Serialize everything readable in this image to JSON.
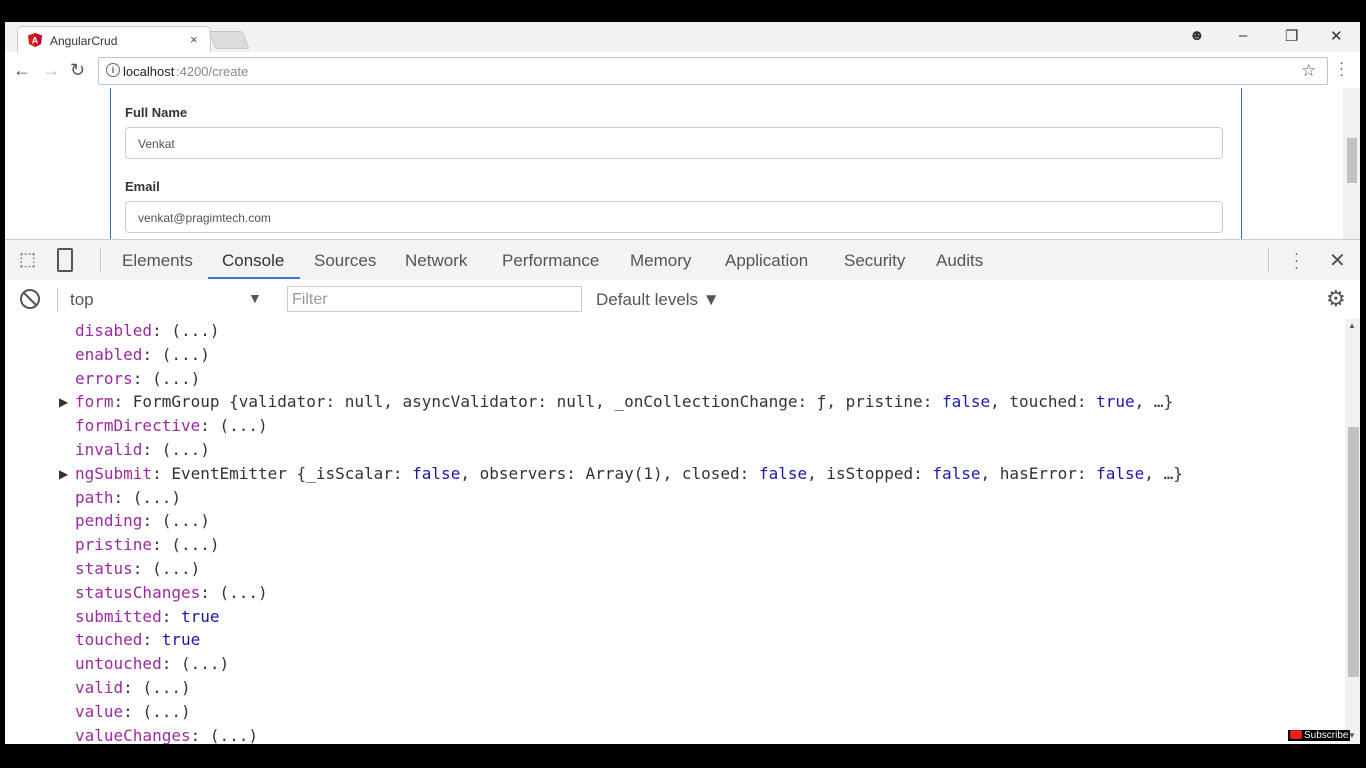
{
  "browser": {
    "tab_title": "AngularCrud",
    "tab_close": "×",
    "window_controls": [
      "–",
      "❐",
      "✕"
    ],
    "url_host": "localhost",
    "url_path": ":4200/create"
  },
  "page": {
    "fields": [
      {
        "label": "Full Name",
        "value": "Venkat"
      },
      {
        "label": "Email",
        "value": "venkat@pragimtech.com"
      }
    ]
  },
  "devtools": {
    "tabs": [
      "Elements",
      "Console",
      "Sources",
      "Network",
      "Performance",
      "Memory",
      "Application",
      "Security",
      "Audits"
    ],
    "active_tab": "Console",
    "context": "top",
    "filter_placeholder": "Filter",
    "levels_label": "Default levels ▼"
  },
  "console": {
    "lines": [
      {
        "key": "disabled",
        "rest": ": (...)"
      },
      {
        "key": "enabled",
        "rest": ": (...)"
      },
      {
        "key": "errors",
        "rest": ": (...)"
      },
      {
        "key": "form",
        "expandable": true,
        "rest": ": FormGroup {validator: null, asyncValidator: null, _onCollectionChange: ƒ, pristine: false, touched: true, …}"
      },
      {
        "key": "formDirective",
        "rest": ": (...)"
      },
      {
        "key": "invalid",
        "rest": ": (...)"
      },
      {
        "key": "ngSubmit",
        "expandable": true,
        "rest": ": EventEmitter {_isScalar: false, observers: Array(1), closed: false, isStopped: false, hasError: false, …}"
      },
      {
        "key": "path",
        "rest": ": (...)"
      },
      {
        "key": "pending",
        "rest": ": (...)"
      },
      {
        "key": "pristine",
        "rest": ": (...)"
      },
      {
        "key": "status",
        "rest": ": (...)"
      },
      {
        "key": "statusChanges",
        "rest": ": (...)"
      },
      {
        "key": "submitted",
        "rest": ": true"
      },
      {
        "key": "touched",
        "rest": ": true"
      },
      {
        "key": "untouched",
        "rest": ": (...)"
      },
      {
        "key": "valid",
        "rest": ": (...)"
      },
      {
        "key": "value",
        "rest": ": (...)"
      },
      {
        "key": "valueChanges",
        "rest": ": (...)"
      }
    ]
  },
  "overlay": {
    "subscribe": "Subscribe"
  },
  "colors": {
    "accent": "#3879d9",
    "property": "#9c2aa0",
    "keyword": "#1a1aa6"
  }
}
